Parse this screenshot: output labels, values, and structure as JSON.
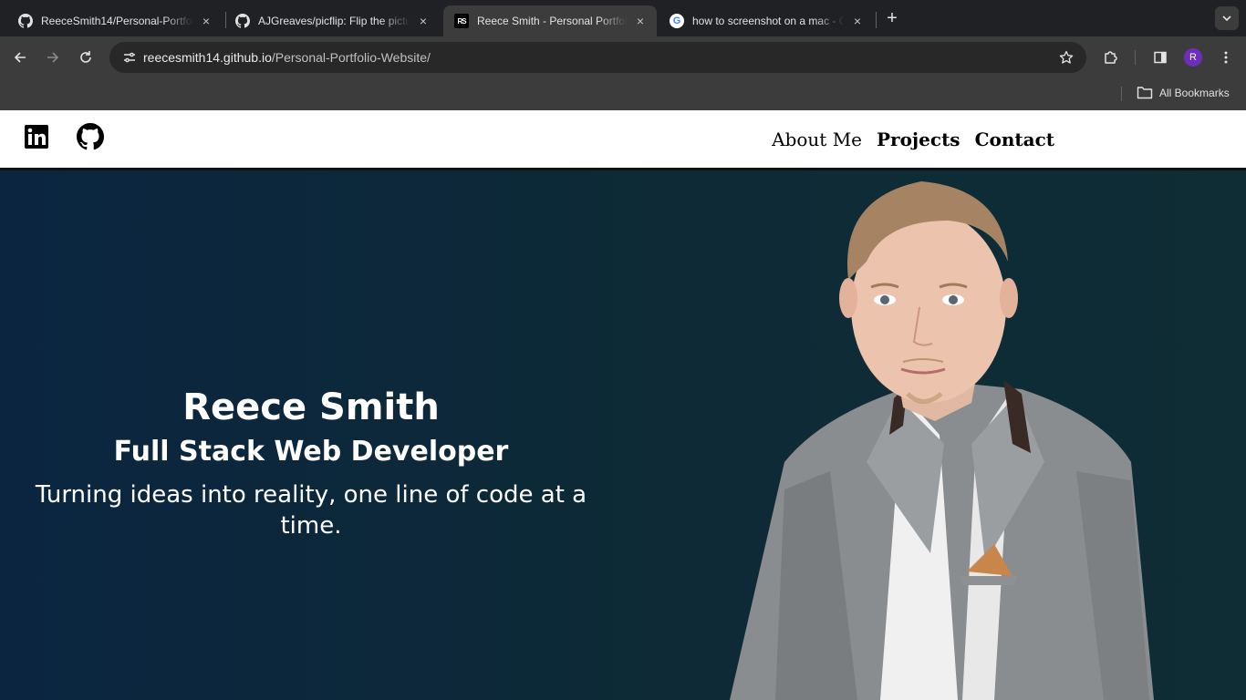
{
  "browser": {
    "tabs": [
      {
        "title": "ReeceSmith14/Personal-Portfolio-Website",
        "favicon": "github-icon",
        "active": false
      },
      {
        "title": "AJGreaves/picflip: Flip the picture",
        "favicon": "github-icon",
        "active": false
      },
      {
        "title": "Reece Smith - Personal Portfolio",
        "favicon": "rs-logo-icon",
        "active": true
      },
      {
        "title": "how to screenshot on a mac - Google Search",
        "favicon": "google-icon",
        "active": false
      }
    ],
    "new_tab_symbol": "+",
    "close_symbol": "×",
    "url_host": "reecesmith14.github.io",
    "url_path": "/Personal-Portfolio-Website/",
    "profile_initial": "R",
    "profile_color": "#6f2dbd",
    "all_bookmarks": "All Bookmarks"
  },
  "site": {
    "social": [
      {
        "name": "linkedin-icon"
      },
      {
        "name": "github-icon"
      }
    ],
    "nav": [
      {
        "label": "About Me"
      },
      {
        "label": "Projects"
      },
      {
        "label": "Contact"
      }
    ],
    "hero": {
      "name": "Reece Smith",
      "role": "Full Stack Web Developer",
      "tagline": "Turning ideas into reality, one line of code at a time."
    }
  },
  "colors": {
    "hero_bg_start": "#0b2540",
    "hero_bg_end": "#0f2d35",
    "chrome_dark": "#202124",
    "chrome_toolbar": "#3c3c3c"
  }
}
